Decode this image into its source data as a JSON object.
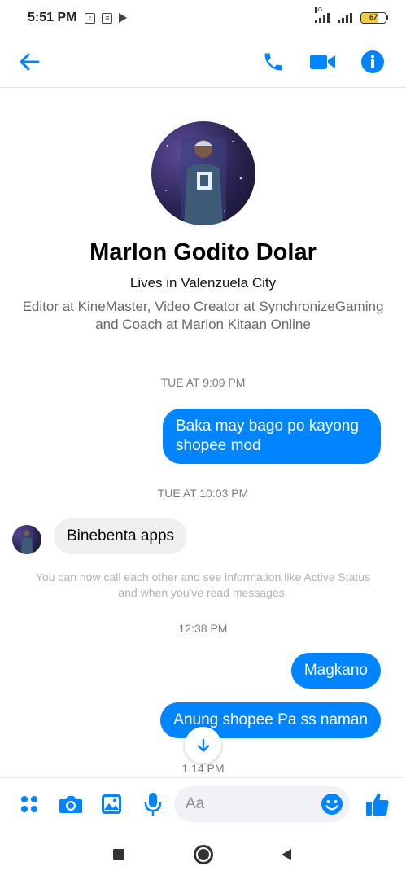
{
  "status_bar": {
    "time": "5:51 PM",
    "icons": [
      "upload-icon",
      "news-icon",
      "play-store-icon"
    ],
    "network_label": "4G",
    "battery_level": "67",
    "battery_fraction": 0.67
  },
  "app_bar": {
    "icons": [
      "back-arrow-icon",
      "phone-icon",
      "video-camera-icon",
      "info-icon"
    ],
    "accent_color": "#0084ff"
  },
  "profile": {
    "name": "Marlon Godito Dolar",
    "location": "Lives in Valenzuela City",
    "work": "Editor at KineMaster, Video Creator at SynchronizeGaming and Coach at Marlon Kitaan Online"
  },
  "messages": {
    "ts1": "TUE AT 9:09 PM",
    "msg1": "Baka may bago po kayong shopee mod",
    "ts2": "TUE AT 10:03 PM",
    "msg2": "Binebenta apps",
    "notice": "You can now call each other and see information like Active Status and when you've read messages.",
    "ts3": "12:38 PM",
    "msg3": "Magkano",
    "msg4": "Anung shopee Pa ss naman",
    "ts4": "1:14 PM"
  },
  "composer": {
    "placeholder": "Aa",
    "icons": [
      "apps-icon",
      "camera-icon",
      "gallery-icon",
      "microphone-icon",
      "emoji-icon",
      "thumbs-up-icon"
    ]
  },
  "nav_bar": {
    "icons": [
      "recents-square-icon",
      "home-circle-icon",
      "back-triangle-icon"
    ]
  }
}
